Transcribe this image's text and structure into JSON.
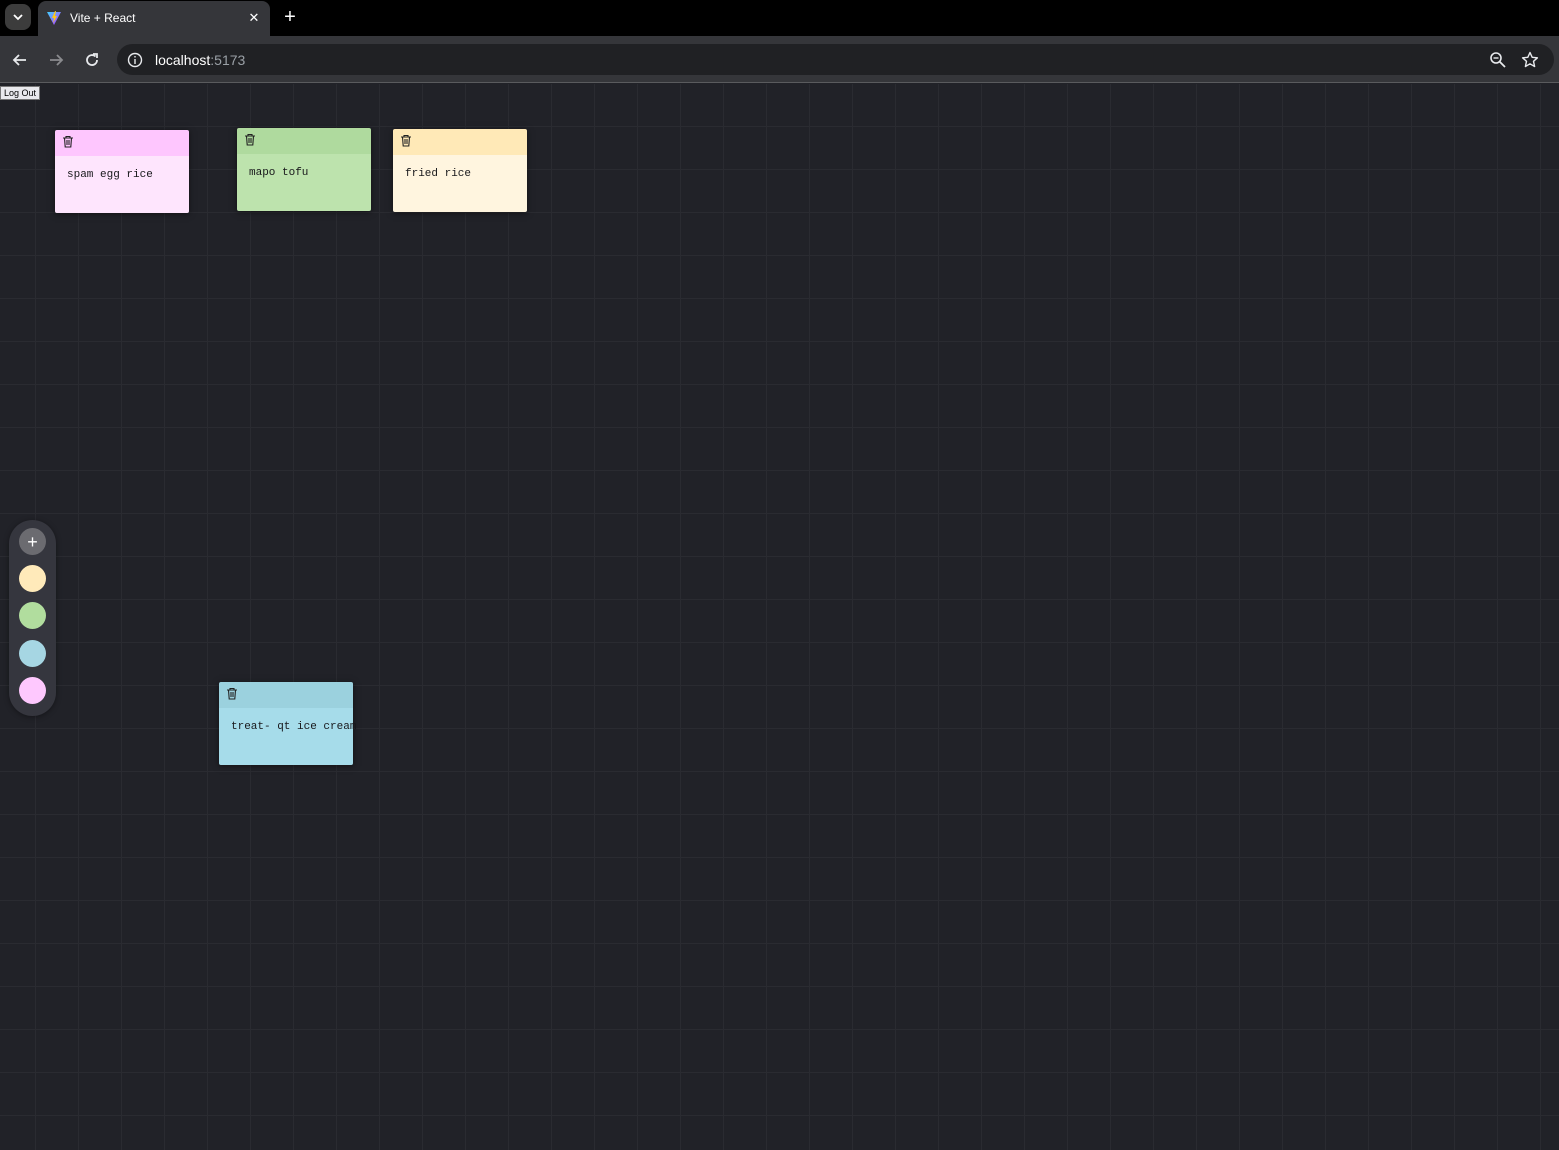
{
  "browser": {
    "tab_title": "Vite + React",
    "url_host": "localhost",
    "url_port": ":5173"
  },
  "app": {
    "logout_label": "Log Out",
    "notes": [
      {
        "text": "spam egg rice",
        "header_color": "#fec6fe",
        "body_color": "#fee5fd"
      },
      {
        "text": "mapo tofu",
        "header_color": "#afda9e",
        "body_color": "#bde3ad"
      },
      {
        "text": "fried rice",
        "header_color": "#ffe9b7",
        "body_color": "#fff5df"
      },
      {
        "text": "treat- qt ice cream",
        "header_color": "#9bd1de",
        "body_color": "#a6dcea"
      }
    ],
    "controls": {
      "add_label": "+",
      "swatches": [
        "#ffeaba",
        "#b1dd9e",
        "#a6d6e3",
        "#fec8fe"
      ]
    }
  }
}
